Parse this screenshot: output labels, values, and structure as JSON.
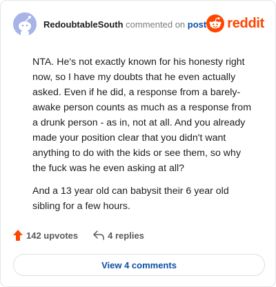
{
  "header": {
    "username": "RedoubtableSouth",
    "action": "commented on",
    "post_link": "post",
    "brand": "reddit"
  },
  "comment": {
    "paragraphs": [
      "NTA. He's not exactly known for his honesty right now, so I have my doubts that he even actually asked. Even if he did, a response from a barely-awake person counts as much as a response from a drunk person - as in, not at all. And you already made your position clear that you didn't want anything to do with the kids or see them, so why the fuck was he even asking at all?",
      "And a 13 year old can babysit their 6 year old sibling for a few hours."
    ]
  },
  "footer": {
    "upvotes": "142 upvotes",
    "replies": "4 replies",
    "upvote_icon": "upvote-arrow-icon",
    "reply_icon": "reply-arrow-icon"
  },
  "view_button": {
    "label": "View 4 comments"
  },
  "colors": {
    "brand": "#ff4500",
    "link": "#0a4ea3",
    "avatar_bg": "#a8b3e8"
  }
}
